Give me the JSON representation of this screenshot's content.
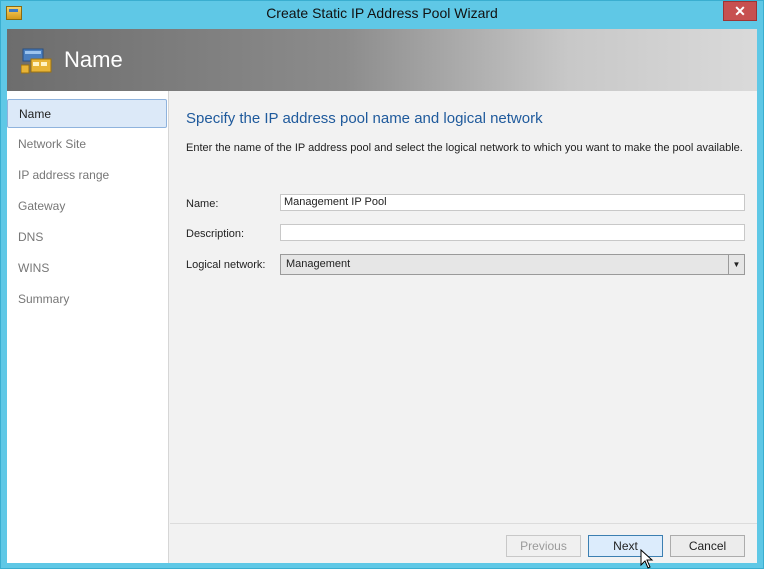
{
  "window": {
    "title": "Create Static IP Address Pool Wizard",
    "close_glyph": "✕"
  },
  "banner": {
    "title": "Name"
  },
  "sidebar": {
    "items": [
      {
        "label": "Name",
        "active": true
      },
      {
        "label": "Network Site",
        "active": false
      },
      {
        "label": "IP address range",
        "active": false
      },
      {
        "label": "Gateway",
        "active": false
      },
      {
        "label": "DNS",
        "active": false
      },
      {
        "label": "WINS",
        "active": false
      },
      {
        "label": "Summary",
        "active": false
      }
    ]
  },
  "main": {
    "heading": "Specify the IP address pool name and logical network",
    "description": "Enter the name of the IP address pool and select the logical network to which you want to make the pool available.",
    "name_label": "Name:",
    "name_value": "Management IP Pool",
    "description_label": "Description:",
    "description_value": "",
    "logical_network_label": "Logical network:",
    "logical_network_value": "Management"
  },
  "footer": {
    "previous_label": "Previous",
    "next_label": "Next",
    "cancel_label": "Cancel"
  },
  "colors": {
    "titlebar": "#5fc8e6",
    "heading": "#1f5a9c",
    "close": "#c75050"
  }
}
